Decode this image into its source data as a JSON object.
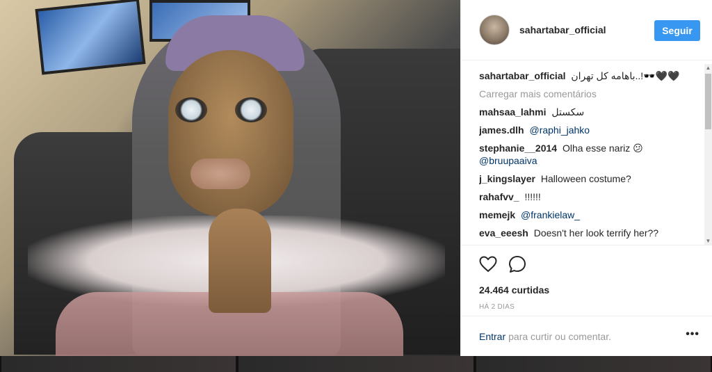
{
  "post": {
    "username": "sahartabar_official",
    "follow_label": "Seguir",
    "caption_user": "sahartabar_official",
    "caption_text": "باهامه کل تهران..!🕶️🖤🖤"
  },
  "comments": {
    "load_more": "Carregar mais comentários",
    "items": [
      {
        "user": "mahsaa_lahmi",
        "text": "سکستل",
        "link": ""
      },
      {
        "user": "james.dlh",
        "text": "",
        "link": "@raphi_jahko"
      },
      {
        "user": "stephanie__2014",
        "text": "Olha esse nariz 😕",
        "link": "@bruupaaiva"
      },
      {
        "user": "j_kingslayer",
        "text": "Halloween costume?",
        "link": ""
      },
      {
        "user": "rahafvv_",
        "text": "!!!!!!",
        "link": ""
      },
      {
        "user": "memejk",
        "text": "",
        "link": "@frankielaw_"
      },
      {
        "user": "eva_eeesh",
        "text": "Doesn't her look terrify her??",
        "link": ""
      }
    ]
  },
  "engagement": {
    "likes": "24.464 curtidas",
    "time": "HÁ 2 DIAS"
  },
  "footer": {
    "login_label": "Entrar",
    "prompt": "para curtir ou comentar.",
    "more_label": "•••"
  },
  "icons": {
    "like": "heart-icon",
    "comment": "comment-icon",
    "more": "more-options-icon"
  },
  "colors": {
    "accent": "#3897f0",
    "link": "#003569",
    "muted": "#999999",
    "text": "#262626"
  }
}
